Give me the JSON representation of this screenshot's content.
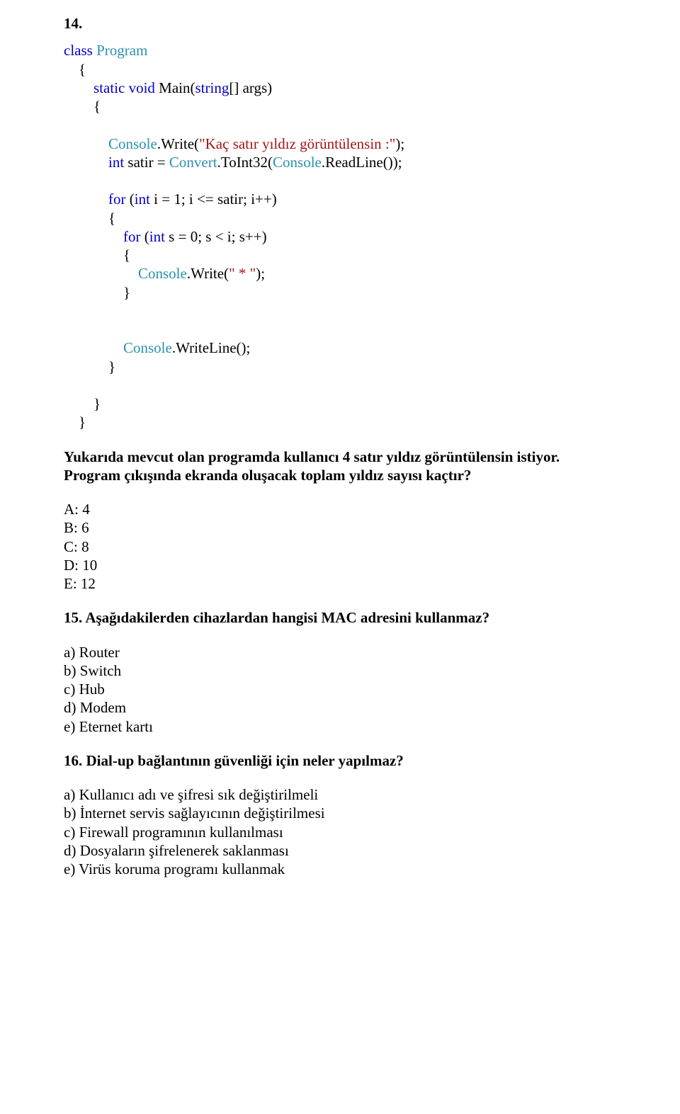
{
  "q14": {
    "number": "14.",
    "code": {
      "l1a": "class",
      "l1b": " Program",
      "l2": "    {",
      "l3a": "        static void",
      "l3b": " Main(",
      "l3c": "string",
      "l3d": "[] args)",
      "l4": "        {",
      "l5a": "            Console",
      "l5b": ".Write(",
      "l5c": "\"Kaç satır yıldız görüntülensin :\"",
      "l5d": ");",
      "l6a": "            int",
      "l6b": " satir = ",
      "l6c": "Convert",
      "l6d": ".ToInt32(",
      "l6e": "Console",
      "l6f": ".ReadLine());",
      "l7a": "            for",
      "l7b": " (",
      "l7c": "int",
      "l7d": " i = 1; i <= satir; i++)",
      "l8": "            {",
      "l9a": "                for",
      "l9b": " (",
      "l9c": "int",
      "l9d": " s = 0; s < i; s++)",
      "l10": "                {",
      "l11a": "                    Console",
      "l11b": ".Write(",
      "l11c": "\" * \"",
      "l11d": ");",
      "l12": "                }",
      "l13a": "                Console",
      "l13b": ".WriteLine();",
      "l14": "            }",
      "l15": "        }",
      "l16": "    }"
    },
    "prompt_line1": "Yukarıda mevcut olan programda kullanıcı 4 satır yıldız görüntülensin istiyor.",
    "prompt_line2": "Program çıkışında ekranda oluşacak toplam yıldız sayısı kaçtır?",
    "opts": {
      "a": "A: 4",
      "b": "B: 6",
      "c": "C: 8",
      "d": "D: 10",
      "e": "E: 12"
    }
  },
  "q15": {
    "heading": "15. Aşağıdakilerden cihazlardan hangisi MAC adresini kullanmaz?",
    "opts": {
      "a": "a)   Router",
      "b": "b)   Switch",
      "c": "c)   Hub",
      "d": "d)   Modem",
      "e": "e)   Eternet kartı"
    }
  },
  "q16": {
    "heading": "16. Dial-up bağlantının güvenliği için neler yapılmaz?",
    "opts": {
      "a": "a)   Kullanıcı adı ve şifresi sık değiştirilmeli",
      "b": "b)   İnternet servis sağlayıcının değiştirilmesi",
      "c": "c)   Firewall programının kullanılması",
      "d": "d)   Dosyaların şifrelenerek saklanması",
      "e": "e)   Virüs  koruma programı kullanmak"
    }
  }
}
